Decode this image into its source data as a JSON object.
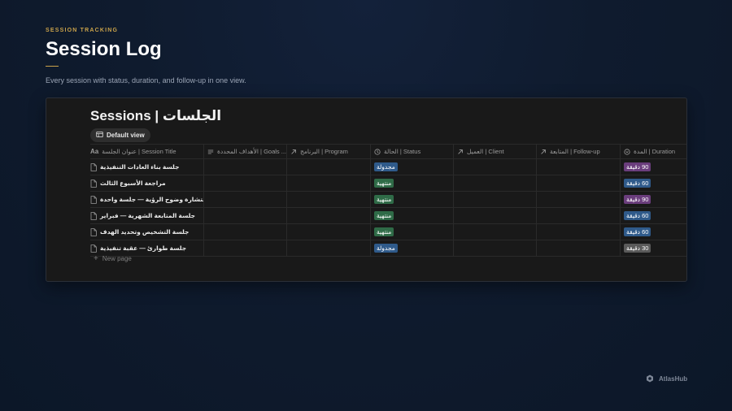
{
  "header": {
    "eyebrow": "SESSION TRACKING",
    "title": "Session Log",
    "subtitle": "Every session with status, duration, and follow-up in one view."
  },
  "database": {
    "title": "Sessions | الجلسات",
    "view_label": "Default view",
    "new_page_label": "New page",
    "columns": [
      {
        "label": "عنوان الجلسة | Session Title",
        "icon": "title-aa-icon"
      },
      {
        "label": "الأهداف المحددة | Goals ...",
        "icon": "text-lines-icon"
      },
      {
        "label": "البرنامج | Program",
        "icon": "relation-arrow-icon"
      },
      {
        "label": "الحالة | Status",
        "icon": "status-circle-icon"
      },
      {
        "label": "العميل | Client",
        "icon": "relation-arrow-icon"
      },
      {
        "label": "المتابعة | Follow-up",
        "icon": "relation-arrow-icon"
      },
      {
        "label": "المدة | Duration",
        "icon": "select-circle-icon"
      }
    ],
    "rows": [
      {
        "title": "جلسة بناء العادات التنفيذية",
        "goals": "",
        "program": "",
        "status": "مجدولة",
        "client": "",
        "followup": "",
        "duration": "90 دقيقة"
      },
      {
        "title": "مراجعة الأسبوع الثالث",
        "goals": "",
        "program": "",
        "status": "منتهية",
        "client": "",
        "followup": "",
        "duration": "60 دقيقة"
      },
      {
        "title": "استشارة وضوح الرؤية — جلسة واحدة",
        "goals": "",
        "program": "",
        "status": "منتهية",
        "client": "",
        "followup": "",
        "duration": "90 دقيقة"
      },
      {
        "title": "جلسة المتابعة الشهرية — فبراير",
        "goals": "",
        "program": "",
        "status": "منتهية",
        "client": "",
        "followup": "",
        "duration": "60 دقيقة"
      },
      {
        "title": "جلسة التشخيص وتحديد الهدف",
        "goals": "",
        "program": "",
        "status": "منتهية",
        "client": "",
        "followup": "",
        "duration": "60 دقيقة"
      },
      {
        "title": "جلسة طوارئ — عقبة تنفيذية",
        "goals": "",
        "program": "",
        "status": "مجدولة",
        "client": "",
        "followup": "",
        "duration": "30 دقيقة"
      }
    ],
    "tag_colors": {
      "مجدولة": "#2f5a8a",
      "منتهية": "#2f6b47",
      "90 دقيقة": "#6a3d7c",
      "60 دقيقة": "#2f5a8a",
      "30 دقيقة": "#5a5a5a"
    }
  },
  "brand": {
    "name": "AtlasHub"
  }
}
